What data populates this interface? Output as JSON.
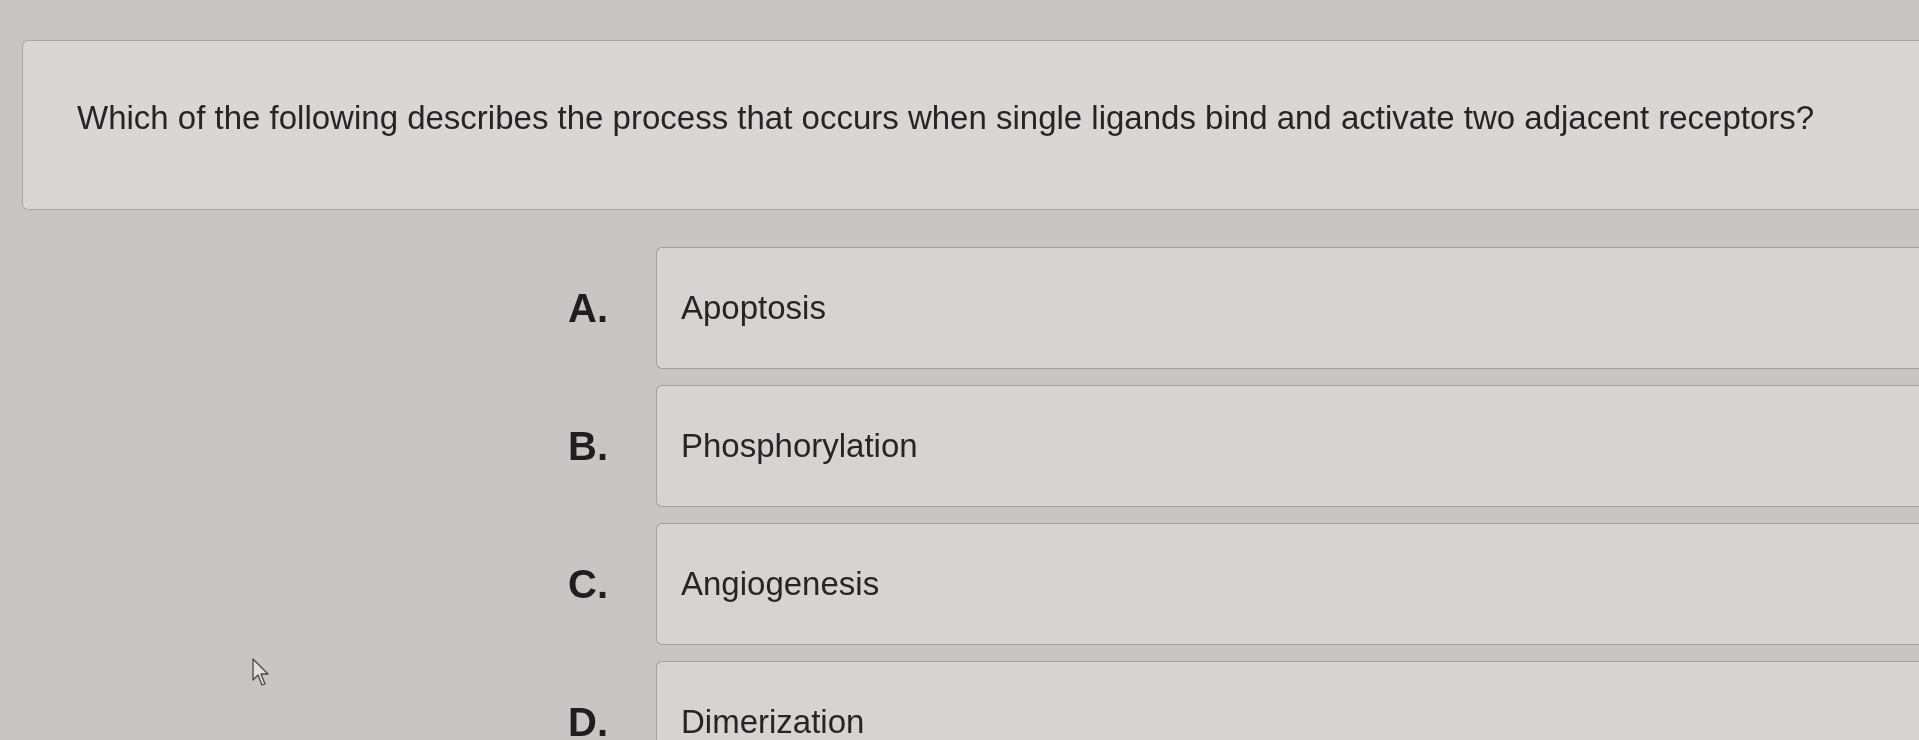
{
  "question": {
    "text": "Which of the following describes the process that occurs when single ligands bind and activate two adjacent receptors?"
  },
  "options": [
    {
      "letter": "A.",
      "text": "Apoptosis",
      "selected": false
    },
    {
      "letter": "B.",
      "text": "Phosphorylation",
      "selected": false
    },
    {
      "letter": "C.",
      "text": "Angiogenesis",
      "selected": false
    },
    {
      "letter": "D.",
      "text": "Dimerization",
      "selected": false
    }
  ]
}
